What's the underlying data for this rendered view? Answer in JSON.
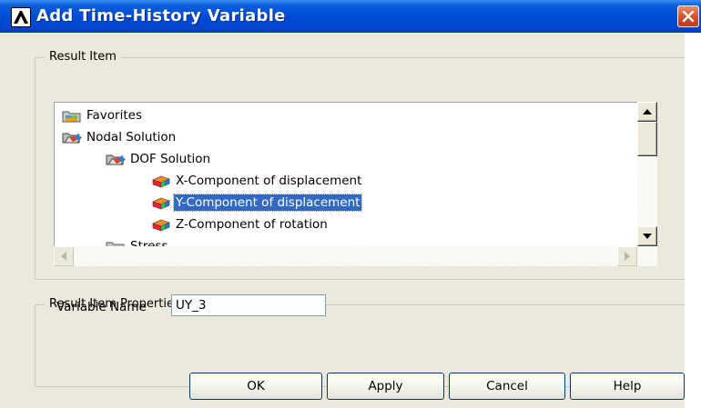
{
  "window": {
    "title": "Add Time-History Variable",
    "title_bar_color": "#0047cf",
    "close_icon": "close-x-icon"
  },
  "result_item": {
    "group_label": "Result Item",
    "tree": [
      {
        "label": "Favorites",
        "icon": "favorites-folder-icon",
        "level": 0,
        "selected": false
      },
      {
        "label": "Nodal Solution",
        "icon": "open-folder-icon",
        "level": 0,
        "selected": false
      },
      {
        "label": "DOF Solution",
        "icon": "open-folder-icon",
        "level": 1,
        "selected": false
      },
      {
        "label": "X-Component of displacement",
        "icon": "result-cube-icon",
        "level": 2,
        "selected": false
      },
      {
        "label": "Y-Component of displacement",
        "icon": "result-cube-icon",
        "level": 2,
        "selected": true
      },
      {
        "label": "Z-Component of rotation",
        "icon": "result-cube-icon",
        "level": 2,
        "selected": false
      },
      {
        "label": "Stress",
        "icon": "closed-folder-icon",
        "level": 1,
        "selected": false
      }
    ],
    "selection_color": "#316ac5"
  },
  "properties": {
    "group_label": "Result Item Properties",
    "variable_name_label": "Variable Name",
    "variable_name_value": "UY_3"
  },
  "buttons": {
    "ok": "OK",
    "apply": "Apply",
    "cancel": "Cancel",
    "help": "Help"
  }
}
